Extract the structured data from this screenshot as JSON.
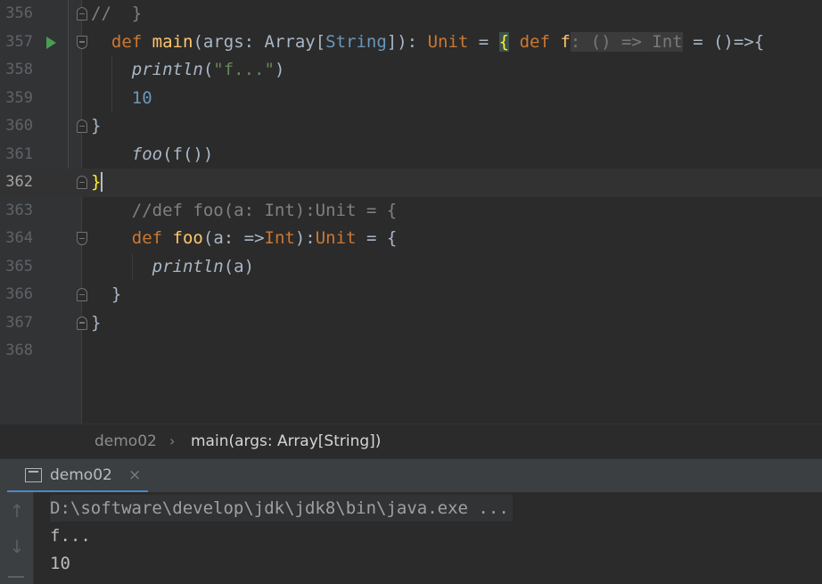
{
  "editor": {
    "lines": [
      {
        "number": "356",
        "fold": "up",
        "tokens": [
          {
            "t": "//  }",
            "c": "cm"
          }
        ]
      },
      {
        "number": "357",
        "fold": "down",
        "run": true,
        "tokens": [
          {
            "t": "  "
          },
          {
            "t": "def",
            "c": "kw"
          },
          {
            "t": " "
          },
          {
            "t": "main",
            "c": "fn"
          },
          {
            "t": "(args: Array["
          },
          {
            "t": "String",
            "c": "ty"
          },
          {
            "t": "]): "
          },
          {
            "t": "Unit",
            "c": "kw"
          },
          {
            "t": " = "
          },
          {
            "t": "{",
            "c": "brace-hl"
          },
          {
            "t": " "
          },
          {
            "t": "def",
            "c": "kw"
          },
          {
            "t": " "
          },
          {
            "t": "f",
            "c": "fn"
          },
          {
            "t": ": () => Int",
            "c": "hint"
          },
          {
            "t": " = ()=>{"
          }
        ]
      },
      {
        "number": "358",
        "indent": [
          125
        ],
        "tokens": [
          {
            "t": "    "
          },
          {
            "t": "println",
            "c": "it"
          },
          {
            "t": "("
          },
          {
            "t": "\"f...\"",
            "c": "st"
          },
          {
            "t": ")"
          }
        ]
      },
      {
        "number": "359",
        "indent": [
          125
        ],
        "tokens": [
          {
            "t": "    "
          },
          {
            "t": "10",
            "c": "num"
          }
        ]
      },
      {
        "number": "360",
        "fold": "up",
        "tokens": [
          {
            "t": "}"
          }
        ]
      },
      {
        "number": "361",
        "tokens": [
          {
            "t": "    "
          },
          {
            "t": "foo",
            "c": "it"
          },
          {
            "t": "(f())"
          }
        ]
      },
      {
        "number": "362",
        "fold": "up",
        "current": true,
        "tokens": [
          {
            "t": "}",
            "c": "brace-cur"
          }
        ]
      },
      {
        "number": "363",
        "tokens": [
          {
            "t": "    "
          },
          {
            "t": "//def foo(a: Int):Unit = {",
            "c": "cm"
          }
        ]
      },
      {
        "number": "364",
        "fold": "down",
        "tokens": [
          {
            "t": "    "
          },
          {
            "t": "def",
            "c": "kw"
          },
          {
            "t": " "
          },
          {
            "t": "foo",
            "c": "fn"
          },
          {
            "t": "(a: =>"
          },
          {
            "t": "Int",
            "c": "kw"
          },
          {
            "t": "):"
          },
          {
            "t": "Unit",
            "c": "kw"
          },
          {
            "t": " = {"
          }
        ]
      },
      {
        "number": "365",
        "indent": [
          148
        ],
        "tokens": [
          {
            "t": "      "
          },
          {
            "t": "println",
            "c": "it"
          },
          {
            "t": "(a)"
          }
        ]
      },
      {
        "number": "366",
        "fold": "up",
        "tokens": [
          {
            "t": "  }"
          }
        ]
      },
      {
        "number": "367",
        "fold": "up",
        "tokens": [
          {
            "t": "}"
          }
        ]
      },
      {
        "number": "368",
        "tokens": []
      }
    ]
  },
  "breadcrumb": {
    "file": "demo02",
    "method": "main(args: Array[String])"
  },
  "run_panel": {
    "tab_label": "demo02",
    "close_glyph": "×",
    "up_arrow": "↑",
    "down_arrow": "↓",
    "output": [
      "D:\\software\\develop\\jdk\\jdk8\\bin\\java.exe ...",
      "f...",
      "10"
    ]
  },
  "colors": {
    "background": "#2b2b2b",
    "keyword": "#cc7832",
    "function": "#ffc66d",
    "string": "#6a8759",
    "number": "#6897bb",
    "comment": "#808080",
    "run_icon": "#499c54",
    "tab_underline": "#4a88c7"
  }
}
